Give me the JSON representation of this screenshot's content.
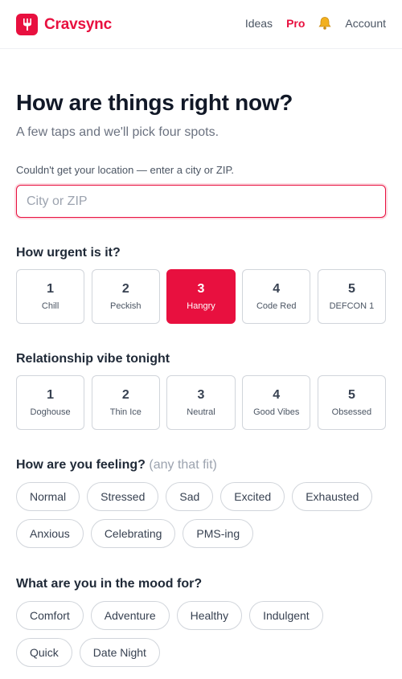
{
  "header": {
    "brand": "Cravsync",
    "nav": {
      "ideas": "Ideas",
      "pro": "Pro",
      "account": "Account"
    },
    "brand_color": "#e8103f"
  },
  "intro": {
    "title": "How are things right now?",
    "subtitle": "A few taps and we'll pick four spots."
  },
  "location": {
    "message": "Couldn't get your location — enter a city or ZIP.",
    "placeholder": "City or ZIP",
    "value": ""
  },
  "urgency": {
    "label": "How urgent is it?",
    "selected": 3,
    "options": [
      {
        "num": "1",
        "label": "Chill"
      },
      {
        "num": "2",
        "label": "Peckish"
      },
      {
        "num": "3",
        "label": "Hangry"
      },
      {
        "num": "4",
        "label": "Code Red"
      },
      {
        "num": "5",
        "label": "DEFCON 1"
      }
    ]
  },
  "vibe": {
    "label": "Relationship vibe tonight",
    "options": [
      {
        "num": "1",
        "label": "Doghouse"
      },
      {
        "num": "2",
        "label": "Thin Ice"
      },
      {
        "num": "3",
        "label": "Neutral"
      },
      {
        "num": "4",
        "label": "Good Vibes"
      },
      {
        "num": "5",
        "label": "Obsessed"
      }
    ]
  },
  "feeling": {
    "label": "How are you feeling?",
    "hint": "(any that fit)",
    "options": [
      "Normal",
      "Stressed",
      "Sad",
      "Excited",
      "Exhausted",
      "Anxious",
      "Celebrating",
      "PMS-ing"
    ]
  },
  "mood": {
    "label": "What are you in the mood for?",
    "options": [
      "Comfort",
      "Adventure",
      "Healthy",
      "Indulgent",
      "Quick",
      "Date Night"
    ]
  }
}
